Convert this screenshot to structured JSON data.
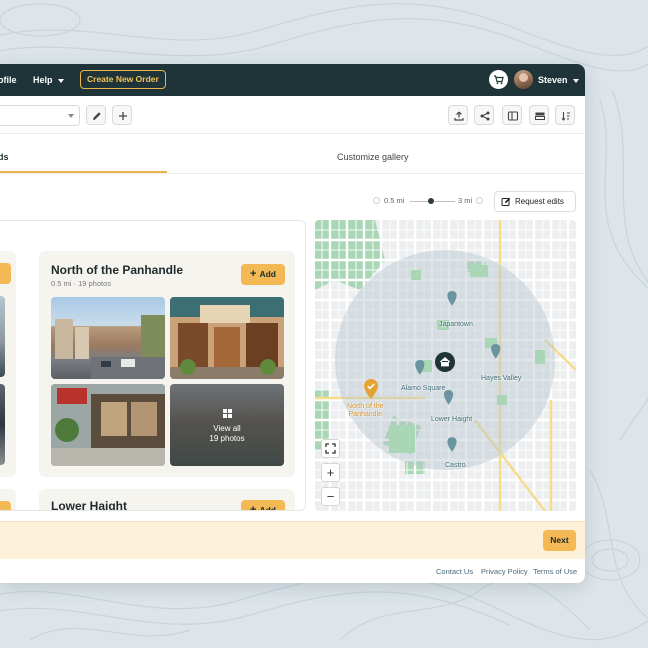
{
  "nav": {
    "profile_partial": "ofile",
    "help": "Help",
    "create_order": "Create New Order",
    "user_name": "Steven"
  },
  "tabs": {
    "first_partial": "ds",
    "customize": "Customize gallery"
  },
  "radius": {
    "min_label": "0.5 mi",
    "max_label": "3 mi"
  },
  "request_edits": "Request edits",
  "add_label": "Add",
  "neighborhoods": [
    {
      "name": "North of the Panhandle",
      "meta": "0.5 mi · 19 photos",
      "view_all": "View all",
      "view_count": "19 photos"
    },
    {
      "name": "Lower Haight"
    }
  ],
  "map": {
    "labels": {
      "japantown": "Japantown",
      "hayes_valley": "Hayes Valley",
      "alamo_square": "Alamo Square",
      "nopa_line1": "North of the",
      "nopa_line2": "Panhandle",
      "lower_haight": "Lower Haight",
      "castro": "Castro"
    },
    "controls": {
      "zoom_in": "+",
      "zoom_out": "−"
    }
  },
  "next": "Next",
  "footer": {
    "contact": "Contact Us",
    "privacy": "Privacy Policy",
    "terms": "Terms of Use"
  },
  "colors": {
    "nav_bg": "#1f3438",
    "accent": "#f2b955",
    "pin": "#6a95a0",
    "selected_pin": "#e4a435",
    "bottom_bar": "#fdf1da"
  },
  "icons": [
    "pencil-icon",
    "plus-icon",
    "upload-icon",
    "share-icon",
    "layout-sidebar-icon",
    "layout-rows-icon",
    "sort-icon",
    "cart-icon",
    "edit-icon",
    "grid-icon",
    "home-icon",
    "fullscreen-icon"
  ]
}
